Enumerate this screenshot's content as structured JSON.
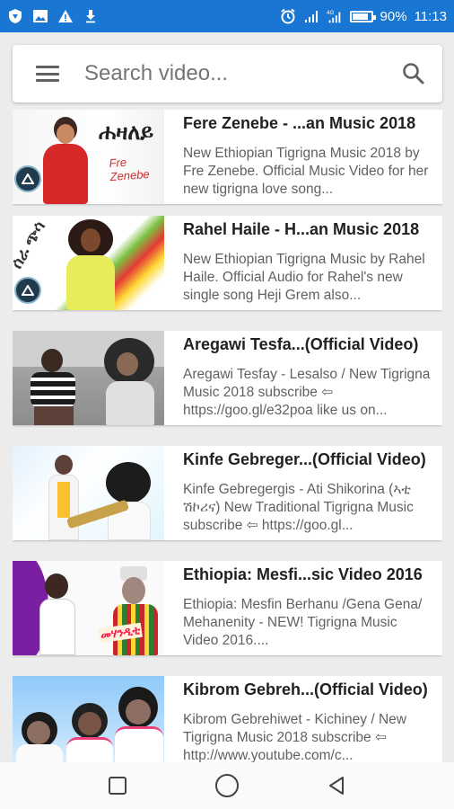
{
  "status_bar": {
    "battery": "90%",
    "time": "11:13",
    "left_icons": [
      "shield-icon",
      "image-icon",
      "warning-icon",
      "download-icon"
    ],
    "right_icons": [
      "alarm-icon",
      "signal-icon",
      "signal-icon",
      "battery-icon"
    ]
  },
  "search": {
    "placeholder": "Search video...",
    "value": ""
  },
  "videos": [
    {
      "title": "Fere Zenebe - ...an Music 2018",
      "description": "New Ethiopian Tigrigna Music 2018 by Fre Zenebe. Official Music Video for her new tigrigna love song...",
      "thumb_text": "Fre Zenebe",
      "thumb_title": "ሐዛለይ"
    },
    {
      "title": "Rahel Haile - H...an Music 2018",
      "description": "New Ethiopian Tigrigna Music by Rahel Haile. Official Audio for Rahel's new single song Heji Grem also...",
      "thumb_title": "ሰራ ጭሳ"
    },
    {
      "title": "Aregawi Tesfa...(Official Video)",
      "description": "Aregawi Tesfay - Lesalso / New Tigrigna Music 2018 subscribe ⇦ https://goo.gl/e32poa like us on..."
    },
    {
      "title": "Kinfe Gebreger...(Official Video)",
      "description": "Kinfe Gebregergis - Ati Shikorina (ኣቲ ሽኮሪና) New Traditional Tigrigna Music subscribe ⇦ https://goo.gl..."
    },
    {
      "title": "Ethiopia: Mesfi...sic Video 2016",
      "description": "Ethiopia: Mesfin Berhanu /Gena Gena/ Mehanenity - NEW! Tigrigna Music Video 2016....",
      "thumb_title": "መሃንዲቲ"
    },
    {
      "title": "Kibrom Gebreh...(Official Video)",
      "description": "Kibrom Gebrehiwet - Kichiney / New Tigrigna Music 2018 subscribe ⇦ http://www.youtube.com/c..."
    }
  ],
  "colors": {
    "status_bar": "#1976d2",
    "background": "#ececec",
    "card": "#ffffff",
    "title_text": "#212121",
    "desc_text": "#616161"
  }
}
